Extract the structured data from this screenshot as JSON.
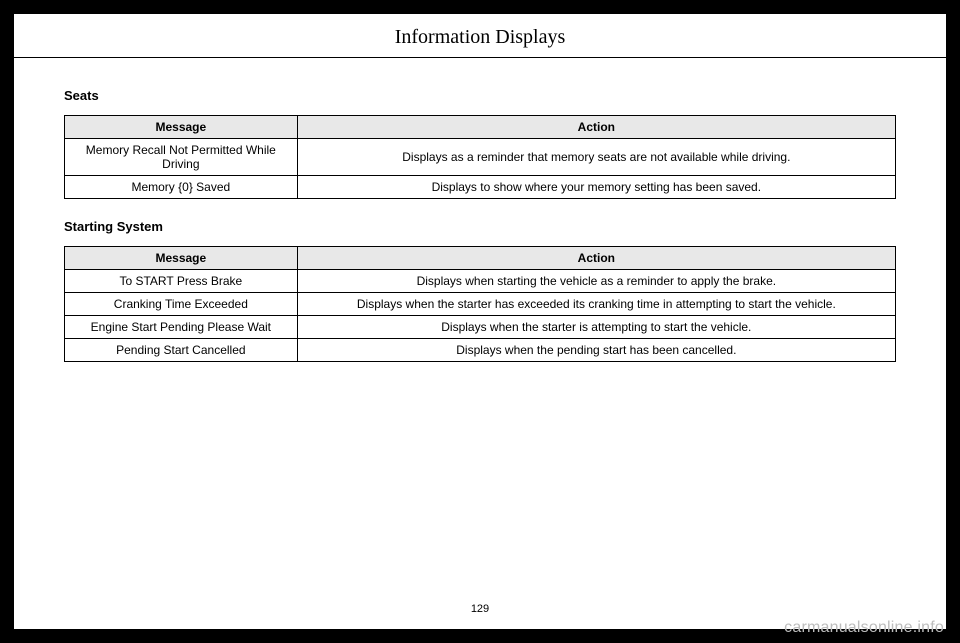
{
  "page_title": "Information Displays",
  "page_number": "129",
  "watermark": "carmanualsonline.info",
  "sections": {
    "seats": {
      "heading": "Seats",
      "headers": {
        "message": "Message",
        "action": "Action"
      },
      "rows": [
        {
          "message": "Memory Recall Not Permitted While Driving",
          "action": "Displays as a reminder that memory seats are not available while driving."
        },
        {
          "message": "Memory {0} Saved",
          "action": "Displays to show where your memory setting has been saved."
        }
      ]
    },
    "starting": {
      "heading": "Starting System",
      "headers": {
        "message": "Message",
        "action": "Action"
      },
      "rows": [
        {
          "message": "To START Press Brake",
          "action": "Displays when starting the vehicle as a reminder to apply the brake."
        },
        {
          "message": "Cranking Time Exceeded",
          "action": "Displays when the starter has exceeded its cranking time in attempting to start the vehicle."
        },
        {
          "message": "Engine Start Pending Please Wait",
          "action": "Displays when the starter is attempting to start the vehicle."
        },
        {
          "message": "Pending Start Cancelled",
          "action": "Displays when the pending start has been cancelled."
        }
      ]
    }
  }
}
